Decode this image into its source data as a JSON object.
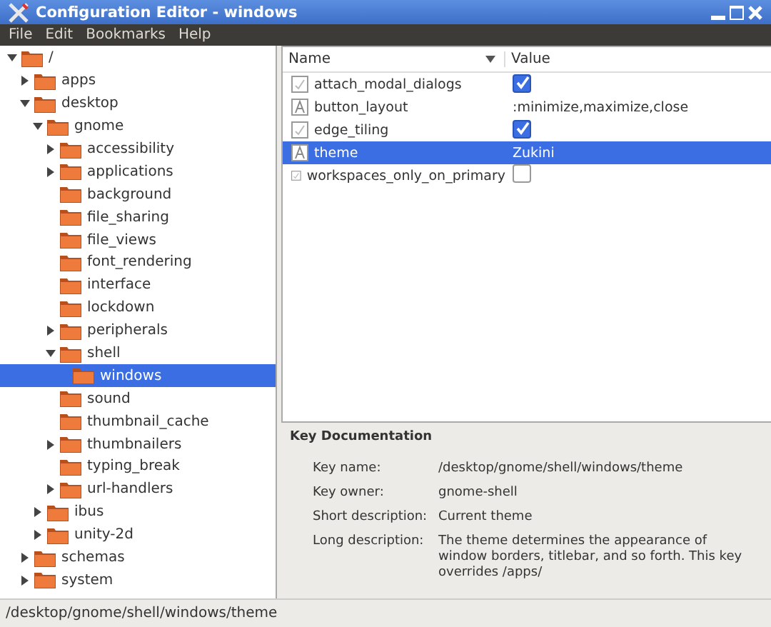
{
  "window": {
    "title": "Configuration Editor - windows"
  },
  "menu": [
    "File",
    "Edit",
    "Bookmarks",
    "Help"
  ],
  "tree": [
    {
      "label": "/",
      "expanded": true,
      "selected": false,
      "children": [
        {
          "label": "apps",
          "expanded": false,
          "selected": false,
          "has_children": true
        },
        {
          "label": "desktop",
          "expanded": true,
          "selected": false,
          "children": [
            {
              "label": "gnome",
              "expanded": true,
              "selected": false,
              "children": [
                {
                  "label": "accessibility",
                  "expanded": false,
                  "selected": false,
                  "has_children": true
                },
                {
                  "label": "applications",
                  "expanded": false,
                  "selected": false,
                  "has_children": true
                },
                {
                  "label": "background",
                  "expanded": false,
                  "selected": false,
                  "has_children": false
                },
                {
                  "label": "file_sharing",
                  "expanded": false,
                  "selected": false,
                  "has_children": false
                },
                {
                  "label": "file_views",
                  "expanded": false,
                  "selected": false,
                  "has_children": false
                },
                {
                  "label": "font_rendering",
                  "expanded": false,
                  "selected": false,
                  "has_children": false
                },
                {
                  "label": "interface",
                  "expanded": false,
                  "selected": false,
                  "has_children": false
                },
                {
                  "label": "lockdown",
                  "expanded": false,
                  "selected": false,
                  "has_children": false
                },
                {
                  "label": "peripherals",
                  "expanded": false,
                  "selected": false,
                  "has_children": true
                },
                {
                  "label": "shell",
                  "expanded": true,
                  "selected": false,
                  "children": [
                    {
                      "label": "windows",
                      "expanded": false,
                      "selected": true,
                      "has_children": false
                    }
                  ]
                },
                {
                  "label": "sound",
                  "expanded": false,
                  "selected": false,
                  "has_children": false
                },
                {
                  "label": "thumbnail_cache",
                  "expanded": false,
                  "selected": false,
                  "has_children": false
                },
                {
                  "label": "thumbnailers",
                  "expanded": false,
                  "selected": false,
                  "has_children": true
                },
                {
                  "label": "typing_break",
                  "expanded": false,
                  "selected": false,
                  "has_children": false
                },
                {
                  "label": "url-handlers",
                  "expanded": false,
                  "selected": false,
                  "has_children": true
                }
              ]
            },
            {
              "label": "ibus",
              "expanded": false,
              "selected": false,
              "has_children": true
            },
            {
              "label": "unity-2d",
              "expanded": false,
              "selected": false,
              "has_children": true
            }
          ]
        },
        {
          "label": "schemas",
          "expanded": false,
          "selected": false,
          "has_children": true
        },
        {
          "label": "system",
          "expanded": false,
          "selected": false,
          "has_children": true
        }
      ]
    }
  ],
  "keys": {
    "columns": [
      "Name",
      "Value"
    ],
    "rows": [
      {
        "name": "attach_modal_dialogs",
        "kind": "bool",
        "checked": true,
        "selected": false
      },
      {
        "name": "button_layout",
        "kind": "string",
        "value": ":minimize,maximize,close",
        "selected": false
      },
      {
        "name": "edge_tiling",
        "kind": "bool",
        "checked": true,
        "selected": false
      },
      {
        "name": "theme",
        "kind": "string",
        "value": "Zukini",
        "selected": true
      },
      {
        "name": "workspaces_only_on_primary",
        "kind": "bool",
        "checked": false,
        "selected": false
      }
    ]
  },
  "documentation": {
    "title": "Key Documentation",
    "fields": [
      {
        "label": "Key name:",
        "value": "/desktop/gnome/shell/windows/theme"
      },
      {
        "label": "Key owner:",
        "value": "gnome-shell"
      },
      {
        "label": "Short description:",
        "value": "Current theme"
      },
      {
        "label": "Long description:",
        "value": "The theme determines the appearance of window borders, titlebar, and so forth. This key overrides /apps/"
      }
    ]
  },
  "status_bar": "/desktop/gnome/shell/windows/theme"
}
